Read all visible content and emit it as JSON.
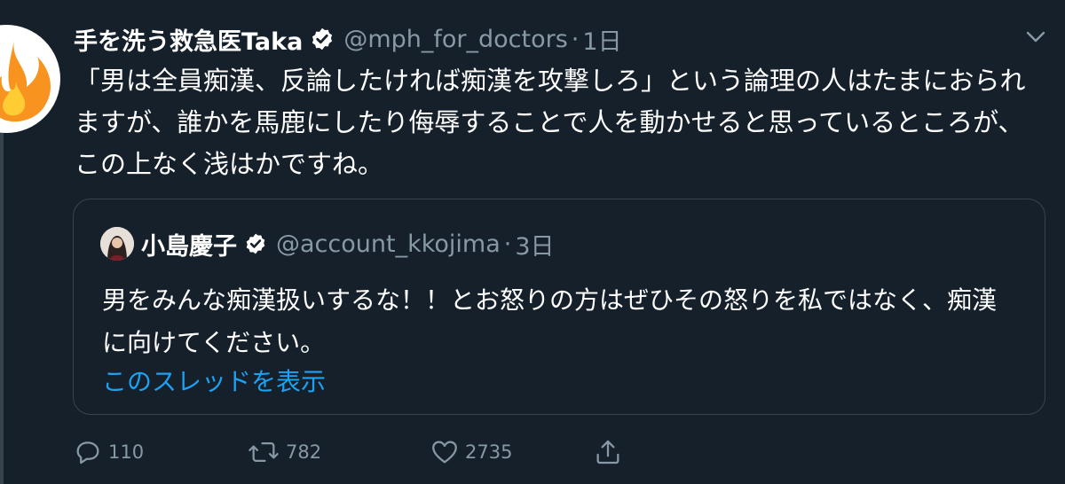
{
  "tweet": {
    "author_name": "手を洗う救急医Taka",
    "handle": "@mph_for_doctors",
    "separator": "·",
    "time": "1日",
    "text": "「男は全員痴漢、反論したければ痴漢を攻撃しろ」という論理の人はたまにおられますが、誰かを馬鹿にしたり侮辱することで人を動かせると思っているところが、この上なく浅はかですね。",
    "verified": true,
    "menu_icon": "chevron-down-icon",
    "avatar_icon": "fire-emoji-icon"
  },
  "quote": {
    "author_name": "小島慶子",
    "handle": "@account_kkojima",
    "separator": "·",
    "time": "3日",
    "text": "男をみんな痴漢扱いするな！！とお怒りの方はぜひその怒りを私ではなく、痴漢に向けてください。",
    "show_thread_label": "このスレッドを表示",
    "verified": true
  },
  "actions": {
    "reply_count": "110",
    "retweet_count": "782",
    "like_count": "2735",
    "reply_icon": "reply-icon",
    "retweet_icon": "retweet-icon",
    "like_icon": "heart-icon",
    "share_icon": "share-icon"
  },
  "colors": {
    "background": "#15202b",
    "secondary_text": "#8899a6",
    "link": "#1da1f2",
    "border": "#38444d"
  }
}
